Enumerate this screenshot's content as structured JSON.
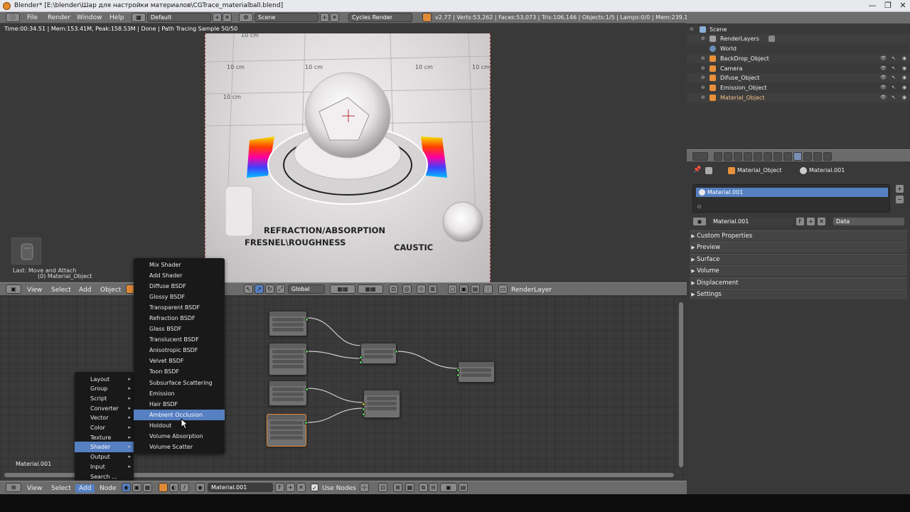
{
  "title_bar": {
    "title": "Blender* [E:\\blender\\Шар для настройки материалов\\CGTrace_materialball.blend]",
    "minimize": "—",
    "maximize": "❐",
    "close": "✕"
  },
  "info_header": {
    "menus": [
      "File",
      "Render",
      "Window",
      "Help"
    ],
    "layout": "Default",
    "scene": "Scene",
    "engine": "Cycles Render",
    "stats": "v2.77 | Verts:53,262 | Faces:53,073 | Tris:106,146 | Objects:1/5 | Lamps:0/0 | Mem:239.11M (68.81M) | Material_Object"
  },
  "viewport": {
    "status": "Time:00:34.51 | Mem:153.41M, Peak:158.53M | Done | Path Tracing Sample 50/50",
    "last_op": "Last: Move and Attach",
    "object_label": "(0) Material_Object",
    "render_labels": {
      "grid": "10 cm",
      "refraction": "REFRACTION/ABSORPTION",
      "fresnel": "FRESNEL\\ROUGHNESS",
      "caustic": "CAUSTIC"
    }
  },
  "viewport_header": {
    "menus": [
      "View",
      "Select",
      "Add",
      "Object"
    ],
    "orientation": "Global",
    "render_layer": "RenderLayer"
  },
  "add_menu": {
    "items": [
      {
        "label": "Layout",
        "sub": true
      },
      {
        "label": "Group",
        "sub": true
      },
      {
        "label": "Script",
        "sub": true
      },
      {
        "label": "Converter",
        "sub": true
      },
      {
        "label": "Vector",
        "sub": true
      },
      {
        "label": "Color",
        "sub": true
      },
      {
        "label": "Texture",
        "sub": true
      },
      {
        "label": "Shader",
        "sub": true
      },
      {
        "label": "Output",
        "sub": true
      },
      {
        "label": "Input",
        "sub": true
      },
      {
        "label": "Search ...",
        "sub": false
      }
    ],
    "selected": "Shader",
    "arrow": "▸"
  },
  "shader_menu": {
    "items": [
      "Mix Shader",
      "Add Shader",
      "Diffuse BSDF",
      "Glossy BSDF",
      "Transparent BSDF",
      "Refraction BSDF",
      "Glass BSDF",
      "Translucent BSDF",
      "Anisotropic BSDF",
      "Velvet BSDF",
      "Toon BSDF",
      "Subsurface Scattering",
      "Emission",
      "Hair BSDF",
      "Ambient Occlusion",
      "Holdout",
      "Volume Absorption",
      "Volume Scatter"
    ],
    "highlighted": "Ambient Occlusion"
  },
  "node_editor": {
    "material_label": "Material.001"
  },
  "node_header": {
    "menus": [
      "View",
      "Select",
      "Add",
      "Node"
    ],
    "active_menu": "Add",
    "material": "Material.001",
    "fake_user": "F",
    "use_nodes": "Use Nodes"
  },
  "outliner": {
    "items": [
      {
        "label": "Scene",
        "icon_color": "#8ab0d8",
        "indent": 0
      },
      {
        "label": "RenderLayers",
        "icon_color": "#a0a0a0",
        "indent": 1
      },
      {
        "label": "World",
        "icon_color": "#6a8cb8",
        "indent": 1
      },
      {
        "label": "BackDrop_Object",
        "icon_color": "#e8903a",
        "indent": 1
      },
      {
        "label": "Camera",
        "icon_color": "#e8903a",
        "indent": 1
      },
      {
        "label": "Difuse_Object",
        "icon_color": "#e8903a",
        "indent": 1
      },
      {
        "label": "Emission_Object",
        "icon_color": "#e8903a",
        "indent": 1
      },
      {
        "label": "Material_Object",
        "icon_color": "#e8903a",
        "indent": 1
      }
    ],
    "vis_icons": [
      "👁",
      "↖",
      "◉"
    ]
  },
  "properties": {
    "breadcrumb_object": "Material_Object",
    "breadcrumb_material": "Material.001",
    "slot": "Material.001",
    "material_field": "Material.001",
    "link": "Data",
    "panels": [
      "Custom Properties",
      "Preview",
      "Surface",
      "Volume",
      "Displacement",
      "Settings"
    ],
    "collapsed_arrow": "▶",
    "plus": "+",
    "minus": "−"
  }
}
